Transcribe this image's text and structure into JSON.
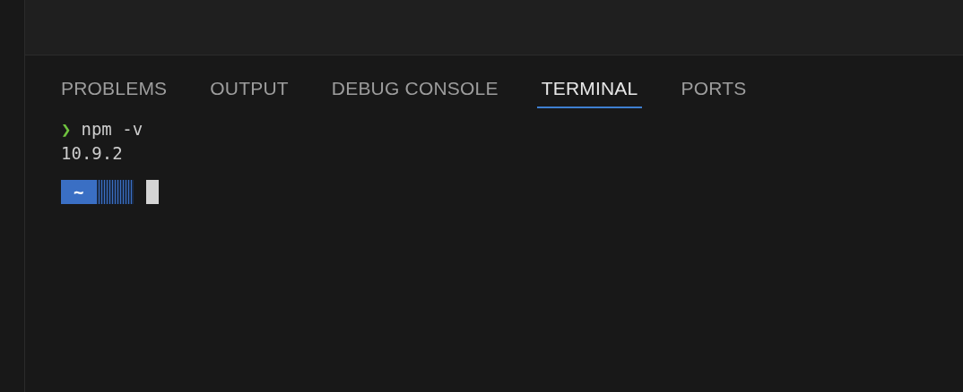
{
  "panel": {
    "tabs": [
      {
        "label": "PROBLEMS",
        "selected": false
      },
      {
        "label": "OUTPUT",
        "selected": false
      },
      {
        "label": "DEBUG CONSOLE",
        "selected": false
      },
      {
        "label": "TERMINAL",
        "selected": true
      },
      {
        "label": "PORTS",
        "selected": false
      }
    ]
  },
  "terminal": {
    "lines": [
      {
        "kind": "command",
        "prompt": "❯",
        "text": "npm -v"
      },
      {
        "kind": "output",
        "text": "10.9.2"
      },
      {
        "kind": "prompt",
        "segment": "~"
      }
    ]
  }
}
